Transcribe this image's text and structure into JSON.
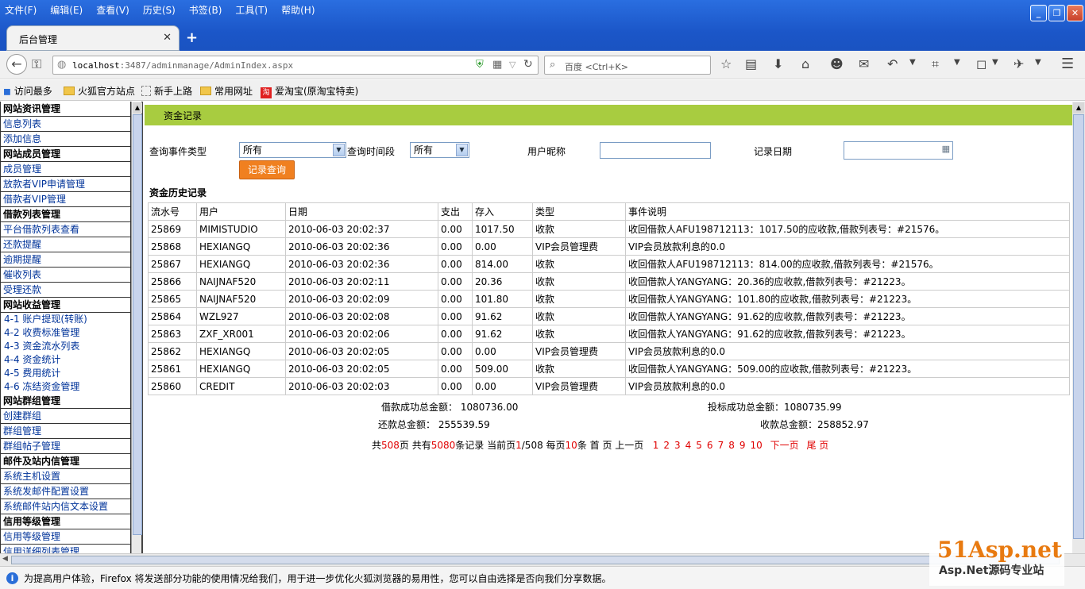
{
  "menu": [
    "文件(F)",
    "编辑(E)",
    "查看(V)",
    "历史(S)",
    "书签(B)",
    "工具(T)",
    "帮助(H)"
  ],
  "tab": {
    "title": "后台管理"
  },
  "url": {
    "host": "localhost",
    "rest": ":3487/adminmanage/AdminIndex.aspx"
  },
  "search": {
    "placeholder": "百度 <Ctrl+K>"
  },
  "bookmarks": [
    "访问最多",
    "火狐官方站点",
    "新手上路",
    "常用网址",
    "爱淘宝(原淘宝特卖)"
  ],
  "sidebar": [
    {
      "type": "h",
      "label": "网站资讯管理"
    },
    {
      "type": "i",
      "label": "信息列表"
    },
    {
      "type": "i",
      "label": "添加信息"
    },
    {
      "type": "h",
      "label": "网站成员管理"
    },
    {
      "type": "i",
      "label": "成员管理"
    },
    {
      "type": "i",
      "label": "放款者VIP申请管理"
    },
    {
      "type": "i",
      "label": "借款者VIP管理"
    },
    {
      "type": "h",
      "label": "借款列表管理"
    },
    {
      "type": "i",
      "label": "平台借款列表查看"
    },
    {
      "type": "i",
      "label": "还款提醒"
    },
    {
      "type": "i",
      "label": "逾期提醒"
    },
    {
      "type": "i",
      "label": "催收列表"
    },
    {
      "type": "i",
      "label": "受理还款"
    },
    {
      "type": "h",
      "label": "网站收益管理"
    },
    {
      "type": "t",
      "label": "4-1 账户提现(转账)"
    },
    {
      "type": "t",
      "label": "4-2 收费标准管理"
    },
    {
      "type": "t",
      "label": "4-3 资金流水列表"
    },
    {
      "type": "t",
      "label": "4-4 资金统计"
    },
    {
      "type": "t",
      "label": "4-5 费用统计"
    },
    {
      "type": "t",
      "label": "4-6 冻结资金管理"
    },
    {
      "type": "h",
      "label": "网站群组管理"
    },
    {
      "type": "i",
      "label": "创建群组"
    },
    {
      "type": "i",
      "label": "群组管理"
    },
    {
      "type": "i",
      "label": "群组帖子管理"
    },
    {
      "type": "h",
      "label": "邮件及站内信管理"
    },
    {
      "type": "i",
      "label": "系统主机设置"
    },
    {
      "type": "i",
      "label": "系统发邮件配置设置"
    },
    {
      "type": "i",
      "label": "系统邮件站内信文本设置"
    },
    {
      "type": "h",
      "label": "信用等级管理"
    },
    {
      "type": "i",
      "label": "信用等级管理"
    },
    {
      "type": "i",
      "label": "信用详细列表管理"
    }
  ],
  "page": {
    "section_title": "资金记录",
    "filters": {
      "event_type_label": "查询事件类型",
      "event_type_value": "所有",
      "period_label": "查询时间段",
      "period_value": "所有",
      "nickname_label": "用户昵称",
      "date_label": "记录日期",
      "query_button": "记录查询"
    },
    "history_title": "资金历史记录",
    "columns": [
      "流水号",
      "用户",
      "日期",
      "支出",
      "存入",
      "类型",
      "事件说明"
    ],
    "rows": [
      [
        "25869",
        "MIMISTUDIO",
        "2010-06-03 20:02:37",
        "0.00",
        "1017.50",
        "收款",
        "收回借款人AFU198712113：1017.50的应收款,借款列表号：#21576。"
      ],
      [
        "25868",
        "HEXIANGQ",
        "2010-06-03 20:02:36",
        "0.00",
        "0.00",
        "VIP会员管理费",
        "VIP会员放款利息的0.0"
      ],
      [
        "25867",
        "HEXIANGQ",
        "2010-06-03 20:02:36",
        "0.00",
        "814.00",
        "收款",
        "收回借款人AFU198712113：814.00的应收款,借款列表号：#21576。"
      ],
      [
        "25866",
        "NAIJNAF520",
        "2010-06-03 20:02:11",
        "0.00",
        "20.36",
        "收款",
        "收回借款人YANGYANG：20.36的应收款,借款列表号：#21223。"
      ],
      [
        "25865",
        "NAIJNAF520",
        "2010-06-03 20:02:09",
        "0.00",
        "101.80",
        "收款",
        "收回借款人YANGYANG：101.80的应收款,借款列表号：#21223。"
      ],
      [
        "25864",
        "WZL927",
        "2010-06-03 20:02:08",
        "0.00",
        "91.62",
        "收款",
        "收回借款人YANGYANG：91.62的应收款,借款列表号：#21223。"
      ],
      [
        "25863",
        "ZXF_XR001",
        "2010-06-03 20:02:06",
        "0.00",
        "91.62",
        "收款",
        "收回借款人YANGYANG：91.62的应收款,借款列表号：#21223。"
      ],
      [
        "25862",
        "HEXIANGQ",
        "2010-06-03 20:02:05",
        "0.00",
        "0.00",
        "VIP会员管理费",
        "VIP会员放款利息的0.0"
      ],
      [
        "25861",
        "HEXIANGQ",
        "2010-06-03 20:02:05",
        "0.00",
        "509.00",
        "收款",
        "收回借款人YANGYANG：509.00的应收款,借款列表号：#21223。"
      ],
      [
        "25860",
        "CREDIT",
        "2010-06-03 20:02:03",
        "0.00",
        "0.00",
        "VIP会员管理费",
        "VIP会员放款利息的0.0"
      ]
    ],
    "summary": {
      "loan_success": "借款成功总金额：   1080736.00",
      "bid_success": "投标成功总金额：1080735.99",
      "repay_total": "还款总金额：   255539.59",
      "receive_total": "收款总金额：258852.97"
    },
    "pager": {
      "p1": "共",
      "total_pages": "508",
      "p2": "页 共有",
      "total_records": "5080",
      "p3": "条记录 当前页",
      "current": "1",
      "p4": "/508 每页",
      "per_page": "10",
      "p5": "条 首 页 上一页",
      "pages": [
        "1",
        "2",
        "3",
        "4",
        "5",
        "6",
        "7",
        "8",
        "9",
        "10"
      ],
      "next": "下一页",
      "last": "尾 页"
    }
  },
  "notice": "为提高用户体验，Firefox 将发送部分功能的使用情况给我们，用于进一步优化火狐浏览器的易用性，您可以自由选择是否向我们分享数据。",
  "watermark": {
    "brand": "51Asp.net",
    "tagline": "Asp.Net源码专业站"
  }
}
